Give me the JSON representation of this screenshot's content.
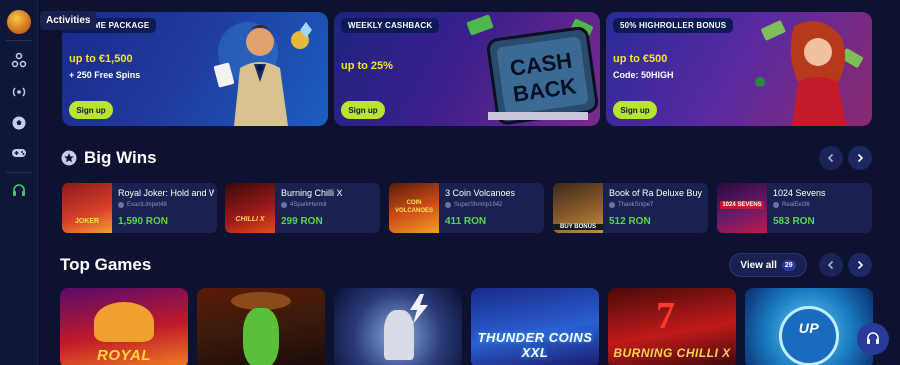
{
  "sidebar": {
    "tooltip": "Activities",
    "icons": [
      "logo-icon",
      "sports-icon",
      "live-icon",
      "football-icon",
      "gamepad-icon",
      "support-icon"
    ]
  },
  "banners": [
    {
      "tag": "WELCOME PACKAGE",
      "headline": "up to €1,500",
      "sub": "+ 250 Free Spins",
      "button": "Sign up"
    },
    {
      "tag": "WEEKLY CASHBACK",
      "headline": "up to 25%",
      "sub": "",
      "button": "Sign up",
      "art_text": [
        "CASH",
        "BACK"
      ]
    },
    {
      "tag": "50% HIGHROLLER BONUS",
      "headline": "up to €500",
      "sub": "Code: 50HIGH",
      "button": "Sign up"
    }
  ],
  "big_wins": {
    "title": "Big Wins",
    "items": [
      {
        "game": "Royal Joker: Hold and Win",
        "user": "ExactLimpet48",
        "amount": "1,590 RON",
        "thumb_text": "JOKER"
      },
      {
        "game": "Burning Chilli X",
        "user": "4SparkHermit",
        "amount": "299 RON",
        "thumb_text": "CHILLI X"
      },
      {
        "game": "3 Coin Volcanoes",
        "user": "SuperShrimp1942",
        "amount": "411 RON",
        "thumb_text": "COIN VOLCANOES"
      },
      {
        "game": "Book of Ra Deluxe Buy",
        "user": "ThankSnipe7",
        "amount": "512 RON",
        "thumb_text": "BUY BONUS"
      },
      {
        "game": "1024 Sevens",
        "user": "RealEel36",
        "amount": "583 RON",
        "thumb_text": "1024 SEVENS"
      }
    ]
  },
  "top_games": {
    "title": "Top Games",
    "view_all": "View all",
    "count": "29",
    "tiles": [
      {
        "label": "ROYAL"
      },
      {
        "label": ""
      },
      {
        "label": ""
      },
      {
        "label": "THUNDER COINS XXL"
      },
      {
        "label": "BURNING CHILLI X"
      },
      {
        "label": "UP"
      }
    ]
  },
  "colors": {
    "background": "#0d1230",
    "accent_green": "#b8e62f",
    "headline_yellow": "#f5e233",
    "win_green": "#56d84a"
  }
}
